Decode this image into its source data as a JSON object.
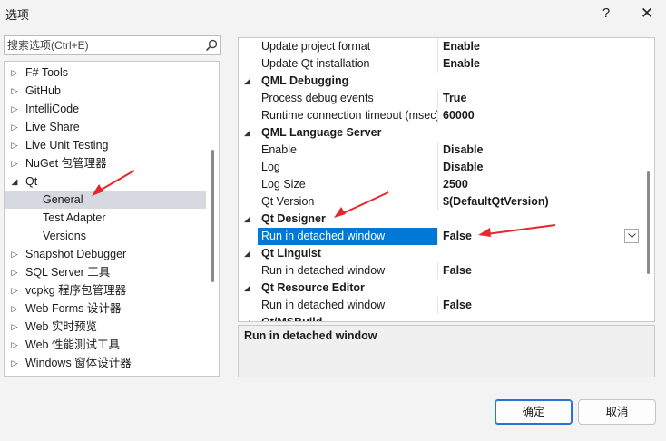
{
  "window": {
    "title": "选项",
    "help_label": "?",
    "close_label": "✕"
  },
  "search": {
    "placeholder": "搜索选项(Ctrl+E)"
  },
  "tree": {
    "items": [
      {
        "label": "F# Tools",
        "expander": "▷"
      },
      {
        "label": "GitHub",
        "expander": "▷"
      },
      {
        "label": "IntelliCode",
        "expander": "▷"
      },
      {
        "label": "Live Share",
        "expander": "▷"
      },
      {
        "label": "Live Unit Testing",
        "expander": "▷"
      },
      {
        "label": "NuGet 包管理器",
        "expander": "▷"
      },
      {
        "label": "Qt",
        "expander": "◢"
      },
      {
        "label": "General",
        "expander": ""
      },
      {
        "label": "Test Adapter",
        "expander": ""
      },
      {
        "label": "Versions",
        "expander": ""
      },
      {
        "label": "Snapshot Debugger",
        "expander": "▷"
      },
      {
        "label": "SQL Server 工具",
        "expander": "▷"
      },
      {
        "label": "vcpkg 程序包管理器",
        "expander": "▷"
      },
      {
        "label": "Web Forms 设计器",
        "expander": "▷"
      },
      {
        "label": "Web 实时预览",
        "expander": "▷"
      },
      {
        "label": "Web 性能测试工具",
        "expander": "▷"
      },
      {
        "label": "Windows 窗体设计器",
        "expander": "▷"
      }
    ],
    "selected": "General"
  },
  "grid": {
    "rows": [
      {
        "kind": "prop",
        "name": "Update project format",
        "value": "Enable"
      },
      {
        "kind": "prop",
        "name": "Update Qt installation",
        "value": "Enable"
      },
      {
        "kind": "cat",
        "name": "QML Debugging",
        "expander": "◢"
      },
      {
        "kind": "prop",
        "name": "Process debug events",
        "value": "True"
      },
      {
        "kind": "prop",
        "name": "Runtime connection timeout (msec)",
        "value": "60000"
      },
      {
        "kind": "cat",
        "name": "QML Language Server",
        "expander": "◢"
      },
      {
        "kind": "prop",
        "name": "Enable",
        "value": "Disable"
      },
      {
        "kind": "prop",
        "name": "Log",
        "value": "Disable"
      },
      {
        "kind": "prop",
        "name": "Log Size",
        "value": "2500"
      },
      {
        "kind": "prop",
        "name": "Qt Version",
        "value": "$(DefaultQtVersion)"
      },
      {
        "kind": "cat",
        "name": "Qt Designer",
        "expander": "◢"
      },
      {
        "kind": "prop",
        "name": "Run in detached window",
        "value": "False",
        "selected": true
      },
      {
        "kind": "cat",
        "name": "Qt Linguist",
        "expander": "◢"
      },
      {
        "kind": "prop",
        "name": "Run in detached window",
        "value": "False"
      },
      {
        "kind": "cat",
        "name": "Qt Resource Editor",
        "expander": "◢"
      },
      {
        "kind": "prop",
        "name": "Run in detached window",
        "value": "False"
      },
      {
        "kind": "cat",
        "name": "Qt/MSBuild",
        "expander": "◢"
      }
    ]
  },
  "description": {
    "text": "Run in detached window"
  },
  "buttons": {
    "ok_label": "确定",
    "cancel_label": "取消"
  },
  "colors": {
    "accent": "#0078d7",
    "annotation_arrow": "#e8262b",
    "tree_selection": "#d6d9df"
  }
}
